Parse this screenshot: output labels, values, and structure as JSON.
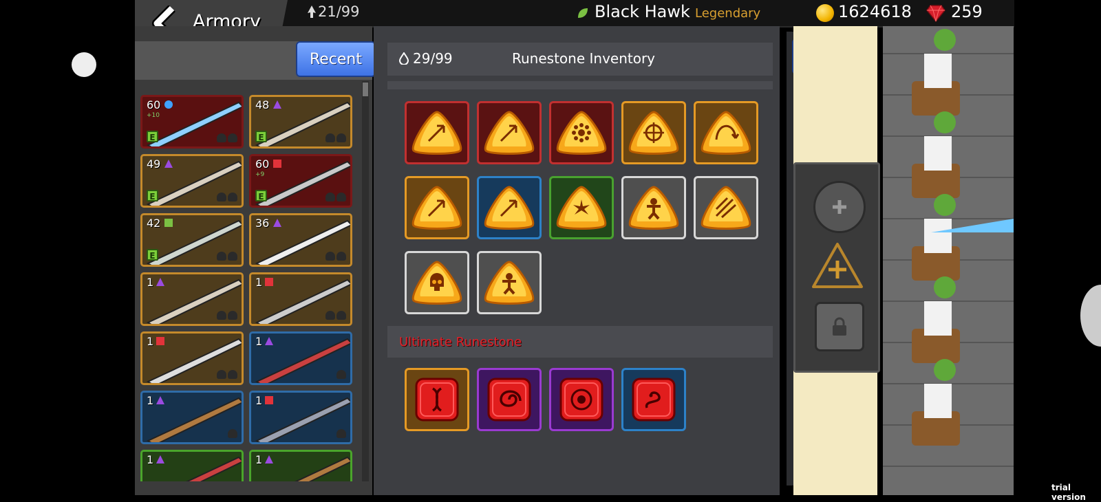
{
  "header": {
    "title": "Armory",
    "arrow_count": "21/99",
    "hero_name": "Black Hawk",
    "hero_rarity": "Legendary",
    "gold": "1624618",
    "gems": "259"
  },
  "left_panel": {
    "recent_label": "Recent",
    "weapons": [
      {
        "level": "60",
        "element": "water",
        "sub": "+10",
        "equipped": true,
        "rarity": "red"
      },
      {
        "level": "48",
        "element": "purple",
        "equipped": true,
        "rarity": "orange"
      },
      {
        "level": "49",
        "element": "purple",
        "equipped": true,
        "rarity": "orange"
      },
      {
        "level": "60",
        "element": "red",
        "sub": "+9",
        "equipped": true,
        "rarity": "red"
      },
      {
        "level": "42",
        "element": "leaf",
        "equipped": true,
        "rarity": "orange"
      },
      {
        "level": "36",
        "element": "purple",
        "equipped": false,
        "rarity": "orange"
      },
      {
        "level": "1",
        "element": "purple",
        "equipped": false,
        "rarity": "orange"
      },
      {
        "level": "1",
        "element": "red",
        "equipped": false,
        "rarity": "orange"
      },
      {
        "level": "1",
        "element": "red",
        "equipped": false,
        "rarity": "orange"
      },
      {
        "level": "1",
        "element": "purple",
        "equipped": false,
        "rarity": "blue"
      },
      {
        "level": "1",
        "element": "purple",
        "equipped": false,
        "rarity": "blue"
      },
      {
        "level": "1",
        "element": "red",
        "equipped": false,
        "rarity": "blue"
      },
      {
        "level": "1",
        "element": "purple",
        "equipped": false,
        "rarity": "green"
      },
      {
        "level": "1",
        "element": "purple",
        "equipped": false,
        "rarity": "green"
      }
    ]
  },
  "inventory": {
    "count": "29/99",
    "title": "Runestone Inventory",
    "runestones": [
      {
        "frame": "red",
        "symbol": "arrow-icon"
      },
      {
        "frame": "red",
        "symbol": "arrow-icon"
      },
      {
        "frame": "red",
        "symbol": "burst-icon"
      },
      {
        "frame": "orange",
        "symbol": "crosshair-icon"
      },
      {
        "frame": "orange",
        "symbol": "curve-arrow-icon"
      },
      {
        "frame": "orange",
        "symbol": "arrow-icon"
      },
      {
        "frame": "blue",
        "symbol": "arrow-icon"
      },
      {
        "frame": "green",
        "symbol": "splash-icon"
      },
      {
        "frame": "gray",
        "symbol": "voodoo-icon"
      },
      {
        "frame": "gray",
        "symbol": "multi-arrow-icon"
      },
      {
        "frame": "gray",
        "symbol": "skull-icon"
      },
      {
        "frame": "gray",
        "symbol": "voodoo-icon"
      }
    ],
    "ultimate_title": "Ultimate Runestone",
    "ultimate": [
      {
        "frame": "orange",
        "symbol": "helix-icon"
      },
      {
        "frame": "purple",
        "symbol": "vortex-icon"
      },
      {
        "frame": "purple",
        "symbol": "spiral-icon"
      },
      {
        "frame": "blue",
        "symbol": "serpent-icon"
      }
    ]
  },
  "footer": {
    "watermark": "trial version"
  },
  "colors": {
    "accent_blue": "#3e73e6",
    "rarity_legendary": "#d9a030",
    "ultimate_red": "#e0222b"
  }
}
